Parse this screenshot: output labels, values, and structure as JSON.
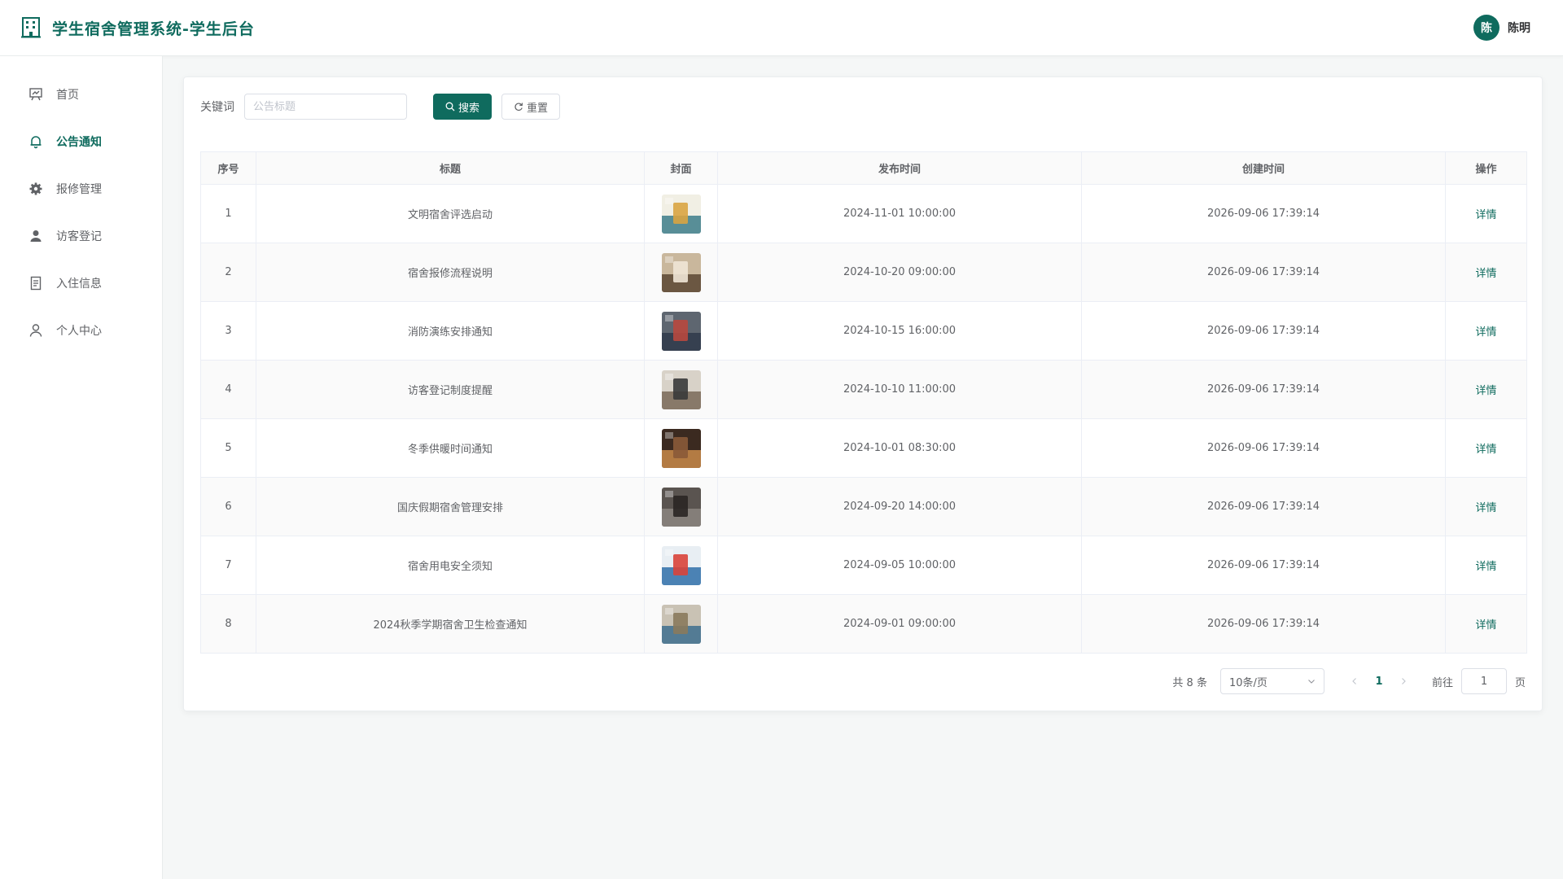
{
  "app": {
    "title": "学生宿舍管理系统-学生后台",
    "brand_color": "#0f6b5e"
  },
  "user": {
    "avatar_text": "陈",
    "name": "陈明"
  },
  "sidebar": {
    "items": [
      {
        "label": "首页",
        "icon": "presentation-board-icon",
        "active": false
      },
      {
        "label": "公告通知",
        "icon": "bell-icon",
        "active": true
      },
      {
        "label": "报修管理",
        "icon": "gear-icon",
        "active": false
      },
      {
        "label": "访客登记",
        "icon": "user-filled-icon",
        "active": false
      },
      {
        "label": "入住信息",
        "icon": "document-icon",
        "active": false
      },
      {
        "label": "个人中心",
        "icon": "user-outline-icon",
        "active": false
      }
    ]
  },
  "search": {
    "label": "关键词",
    "placeholder": "公告标题",
    "value": "",
    "search_button": "搜索",
    "reset_button": "重置"
  },
  "table": {
    "columns": [
      "序号",
      "标题",
      "封面",
      "发布时间",
      "创建时间",
      "操作"
    ],
    "rows": [
      {
        "index": "1",
        "title": "文明宿舍评选启动",
        "publish_time": "2024-11-01 10:00:00",
        "create_time": "2026-09-06 17:39:14",
        "action": "详情",
        "cover_colors": [
          "#f1efe4",
          "#3d7c8a",
          "#d9a441"
        ]
      },
      {
        "index": "2",
        "title": "宿舍报修流程说明",
        "publish_time": "2024-10-20 09:00:00",
        "create_time": "2026-09-06 17:39:14",
        "action": "详情",
        "cover_colors": [
          "#c9b79c",
          "#5a4632",
          "#efe6d6"
        ]
      },
      {
        "index": "3",
        "title": "消防演练安排通知",
        "publish_time": "2024-10-15 16:00:00",
        "create_time": "2026-09-06 17:39:14",
        "action": "详情",
        "cover_colors": [
          "#5e6670",
          "#2f3a4a",
          "#b8483e"
        ]
      },
      {
        "index": "4",
        "title": "访客登记制度提醒",
        "publish_time": "2024-10-10 11:00:00",
        "create_time": "2026-09-06 17:39:14",
        "action": "详情",
        "cover_colors": [
          "#d8d2c8",
          "#7a6a58",
          "#3a3a3a"
        ]
      },
      {
        "index": "5",
        "title": "冬季供暖时间通知",
        "publish_time": "2024-10-01 08:30:00",
        "create_time": "2026-09-06 17:39:14",
        "action": "详情",
        "cover_colors": [
          "#3b2a20",
          "#c98a4a",
          "#8a5a38"
        ]
      },
      {
        "index": "6",
        "title": "国庆假期宿舍管理安排",
        "publish_time": "2024-09-20 14:00:00",
        "create_time": "2026-09-06 17:39:14",
        "action": "详情",
        "cover_colors": [
          "#5a5450",
          "#8c8680",
          "#2a2624"
        ]
      },
      {
        "index": "7",
        "title": "宿舍用电安全须知",
        "publish_time": "2024-09-05 10:00:00",
        "create_time": "2026-09-06 17:39:14",
        "action": "详情",
        "cover_colors": [
          "#e8eef3",
          "#2f6fa8",
          "#d9423a"
        ]
      },
      {
        "index": "8",
        "title": "2024秋季学期宿舍卫生检查通知",
        "publish_time": "2024-09-01 09:00:00",
        "create_time": "2026-09-06 17:39:14",
        "action": "详情",
        "cover_colors": [
          "#c9c2b4",
          "#3e6f8e",
          "#8a7a5c"
        ]
      }
    ]
  },
  "pagination": {
    "total_text": "共 8 条",
    "page_size": "10条/页",
    "current_page": "1",
    "goto_label": "前往",
    "goto_value": "1",
    "page_suffix": "页"
  }
}
